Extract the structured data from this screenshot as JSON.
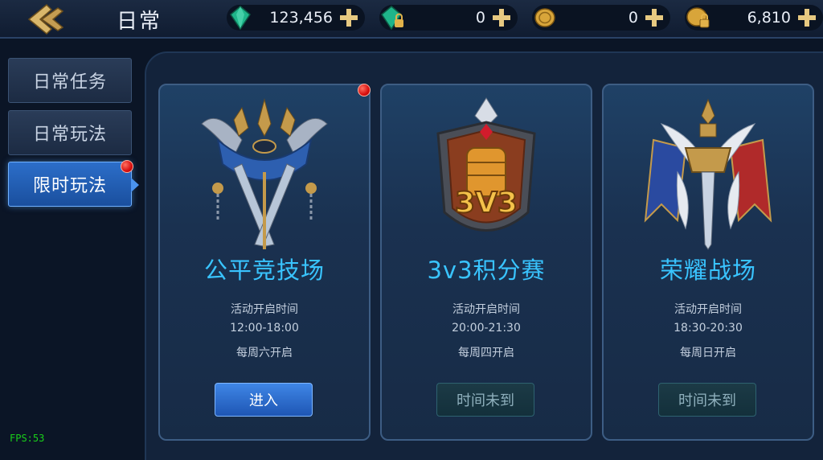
{
  "header": {
    "title": "日常",
    "back_icon": "back-arrow-icon",
    "resources": [
      {
        "icon": "green-gem-icon",
        "value": "123,456"
      },
      {
        "icon": "locked-gem-icon",
        "value": "0"
      },
      {
        "icon": "gold-coin-icon",
        "value": "0"
      },
      {
        "icon": "locked-coin-icon",
        "value": "6,810"
      }
    ]
  },
  "sidebar": {
    "items": [
      {
        "label": "日常任务",
        "active": false
      },
      {
        "label": "日常玩法",
        "active": false
      },
      {
        "label": "限时玩法",
        "active": true,
        "badge": true
      }
    ]
  },
  "cards": [
    {
      "title": "公平竞技场",
      "info_label": "活动开启时间",
      "time": "12:00-18:00",
      "day": "每周六开启",
      "button": "进入",
      "button_state": "enabled",
      "badge": true,
      "emblem": "crossed-swords-emblem-icon"
    },
    {
      "title": "3v3积分赛",
      "info_label": "活动开启时间",
      "time": "20:00-21:30",
      "day": "每周四开启",
      "button": "时间未到",
      "button_state": "disabled",
      "emblem_text": "3V3",
      "emblem": "fist-shield-emblem-icon"
    },
    {
      "title": "荣耀战场",
      "info_label": "活动开启时间",
      "time": "18:30-20:30",
      "day": "每周日开启",
      "button": "时间未到",
      "button_state": "disabled",
      "emblem": "winged-sword-banner-emblem-icon"
    }
  ],
  "debug": {
    "fps": "FPS:53"
  },
  "colors": {
    "accent": "#39c4ff",
    "active_tab": "#2c6ec9",
    "badge": "#d80f0f"
  }
}
